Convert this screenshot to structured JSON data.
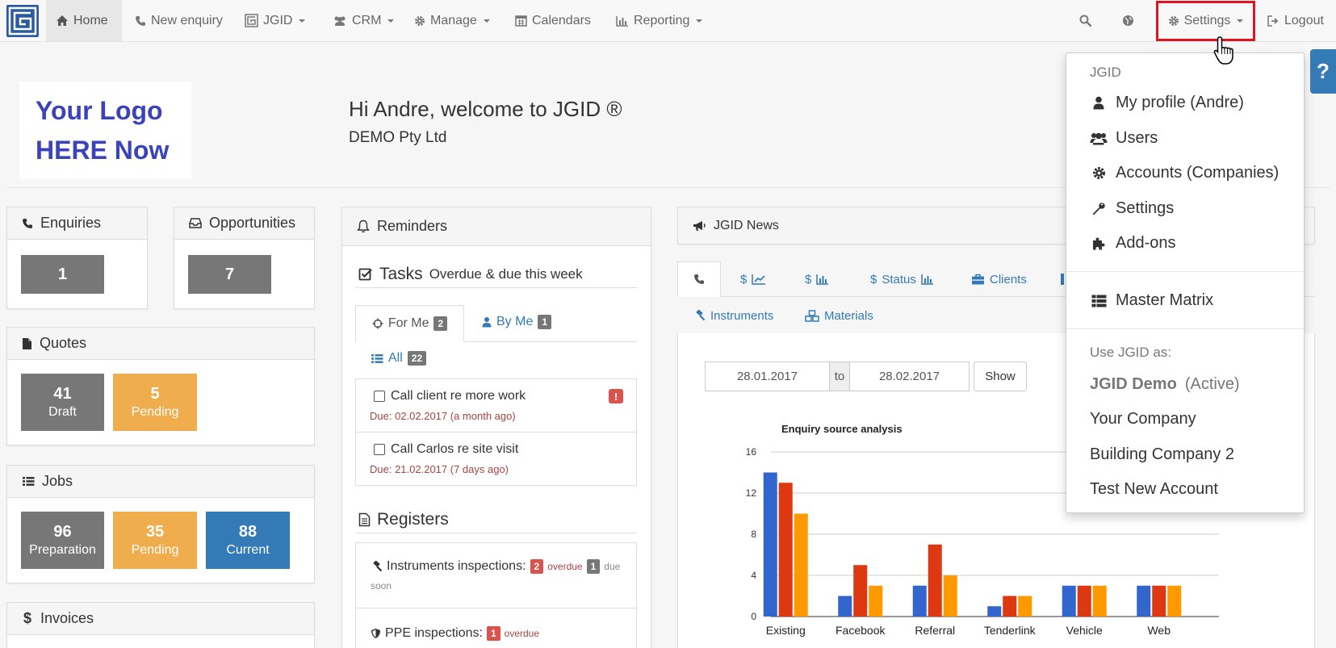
{
  "nav": {
    "home": "Home",
    "new_enquiry": "New enquiry",
    "jgid": "JGID",
    "crm": "CRM",
    "manage": "Manage",
    "calendars": "Calendars",
    "reporting": "Reporting",
    "settings": "Settings",
    "logout": "Logout"
  },
  "header": {
    "logo_line1": "Your Logo",
    "logo_line2": "HERE Now",
    "welcome": "Hi Andre, welcome to JGID ®",
    "company": "DEMO Pty Ltd"
  },
  "enquiries": {
    "title": "Enquiries",
    "count": "1"
  },
  "opportunities": {
    "title": "Opportunities",
    "count": "7"
  },
  "quotes": {
    "title": "Quotes",
    "draft_count": "41",
    "draft_label": "Draft",
    "pending_count": "5",
    "pending_label": "Pending"
  },
  "jobs": {
    "title": "Jobs",
    "prep_count": "96",
    "prep_label": "Preparation",
    "pending_count": "35",
    "pending_label": "Pending",
    "current_count": "88",
    "current_label": "Current"
  },
  "invoices": {
    "title": "Invoices"
  },
  "reminders": {
    "title": "Reminders",
    "tasks_title": "Tasks",
    "tasks_subtitle": "Overdue & due this week",
    "tab_for_me": "For Me",
    "tab_for_me_count": "2",
    "tab_by_me": "By Me",
    "tab_by_me_count": "1",
    "tab_all": "All",
    "tab_all_count": "22",
    "tasks": [
      {
        "title": "Call client re more work",
        "due": "Due: 02.02.2017 (a month ago)",
        "flag": "!"
      },
      {
        "title": "Call Carlos re site visit",
        "due": "Due: 21.02.2017 (7 days ago)"
      }
    ],
    "registers_title": "Registers",
    "registers": [
      {
        "name": "Instruments inspections:",
        "overdue_count": "2",
        "overdue_label": "overdue",
        "soon_count": "1",
        "soon_label": "due",
        "soon_label2": "soon"
      },
      {
        "name": "PPE inspections:",
        "overdue_count": "1",
        "overdue_label": "overdue"
      }
    ]
  },
  "news": {
    "title": "JGID News",
    "tab_dollar": "$",
    "tab_status": "Status",
    "tab_clients": "Clients",
    "tab_instruments": "Instruments",
    "tab_materials": "Materials",
    "date_from": "28.01.2017",
    "date_to_label": "to",
    "date_to": "28.02.2017",
    "show_button": "Show"
  },
  "chart_data": {
    "type": "bar",
    "title": "Enquiry source analysis",
    "categories": [
      "Existing",
      "Facebook",
      "Referral",
      "Tenderlink",
      "Vehicle",
      "Web"
    ],
    "ylim": [
      0,
      16
    ],
    "yticks": [
      0,
      4,
      8,
      12,
      16
    ],
    "series": [
      {
        "values": [
          14,
          2,
          3,
          1,
          3,
          3
        ],
        "color": "#3366cc"
      },
      {
        "values": [
          13,
          5,
          7,
          2,
          3,
          3
        ],
        "color": "#dc3912"
      },
      {
        "values": [
          10,
          3,
          4,
          2,
          3,
          3
        ],
        "color": "#ff9900"
      }
    ]
  },
  "settings_menu": {
    "section_header": "JGID",
    "items": [
      {
        "label": "My profile (Andre)",
        "icon": "user-icon"
      },
      {
        "label": "Users",
        "icon": "users-icon"
      },
      {
        "label": "Accounts (Companies)",
        "icon": "gear-icon"
      },
      {
        "label": "Settings",
        "icon": "wrench-icon"
      },
      {
        "label": "Add-ons",
        "icon": "puzzle-icon"
      }
    ],
    "master_matrix": "Master Matrix",
    "use_as_header": "Use JGID as:",
    "accounts": [
      {
        "label": "JGID Demo",
        "note": "(Active)"
      },
      {
        "label": "Your Company"
      },
      {
        "label": "Building Company 2"
      },
      {
        "label": "Test New Account"
      }
    ]
  },
  "help": {
    "label": "?"
  }
}
